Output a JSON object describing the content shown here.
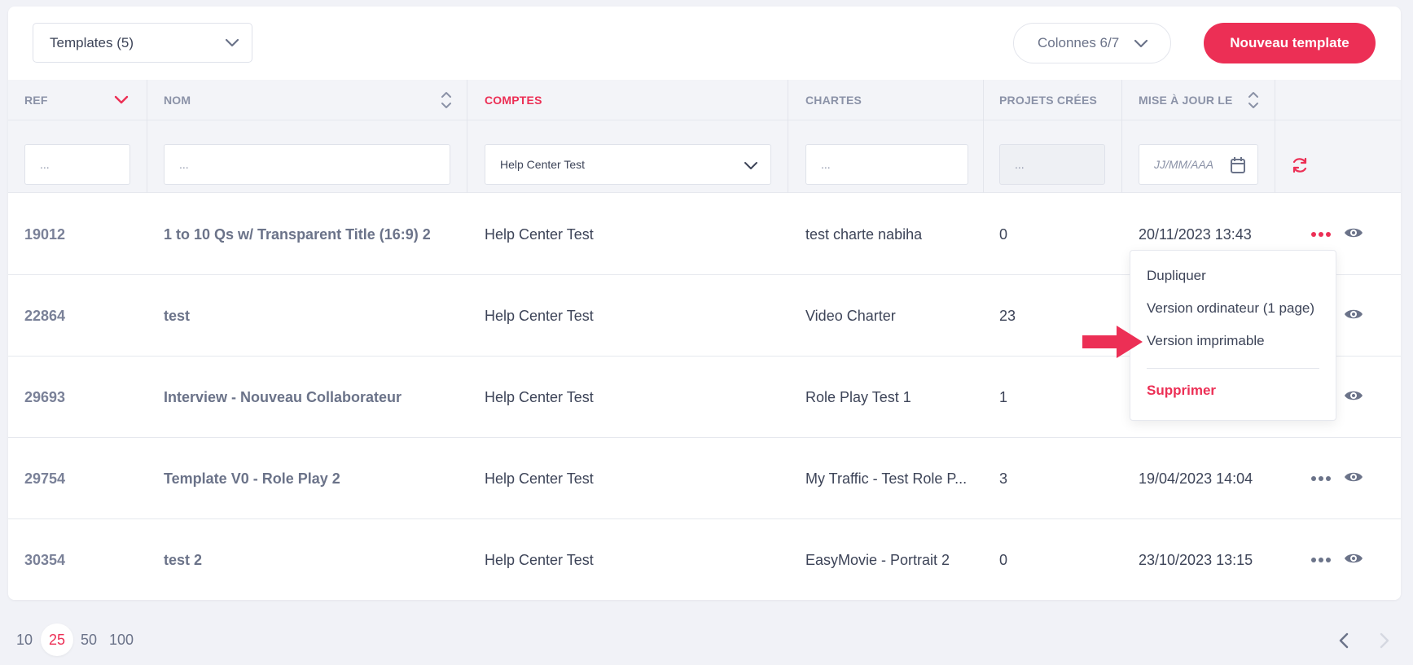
{
  "toolbar": {
    "templates_select": "Templates (5)",
    "columns_button": "Colonnes 6/7",
    "new_button": "Nouveau template"
  },
  "table": {
    "headers": {
      "ref": "REF",
      "nom": "NOM",
      "comptes": "COMPTES",
      "chartes": "CHARTES",
      "projets": "PROJETS CRÉES",
      "maj": "MISE À JOUR LE"
    },
    "filters": {
      "ref_placeholder": "...",
      "nom_placeholder": "...",
      "comptes_value": "Help Center Test",
      "chartes_placeholder": "...",
      "projets_placeholder": "...",
      "date_placeholder": "JJ/MM/AAA"
    },
    "rows": [
      {
        "ref": "19012",
        "nom": "1 to 10 Qs w/ Transparent Title (16:9) 2",
        "compte": "Help Center Test",
        "charte": "test charte nabiha",
        "projets": "0",
        "date": "20/11/2023 13:43"
      },
      {
        "ref": "22864",
        "nom": "test",
        "compte": "Help Center Test",
        "charte": "Video Charter",
        "projets": "23",
        "date": ""
      },
      {
        "ref": "29693",
        "nom": "Interview - Nouveau Collaborateur",
        "compte": "Help Center Test",
        "charte": "Role Play Test 1",
        "projets": "1",
        "date": ""
      },
      {
        "ref": "29754",
        "nom": "Template V0 - Role Play 2",
        "compte": "Help Center Test",
        "charte": "My Traffic - Test Role P...",
        "projets": "3",
        "date": "19/04/2023 14:04"
      },
      {
        "ref": "30354",
        "nom": "test 2",
        "compte": "Help Center Test",
        "charte": "EasyMovie - Portrait 2",
        "projets": "0",
        "date": "23/10/2023 13:15"
      }
    ]
  },
  "menu": {
    "items": [
      "Dupliquer",
      "Version ordinateur (1 page)",
      "Version imprimable"
    ],
    "delete": "Supprimer"
  },
  "pagination": {
    "sizes": [
      "10",
      "25",
      "50",
      "100"
    ],
    "active": "25"
  },
  "colors": {
    "accent": "#ec2f55",
    "text": "#3d4458",
    "muted": "#8b92a7",
    "background": "#f1f2f7"
  },
  "icons": [
    "chevron-down-icon",
    "sort-icon",
    "calendar-icon",
    "refresh-icon",
    "more-dots-icon",
    "eye-icon",
    "arrow-right-icon",
    "chevron-left-icon",
    "chevron-right-icon"
  ]
}
